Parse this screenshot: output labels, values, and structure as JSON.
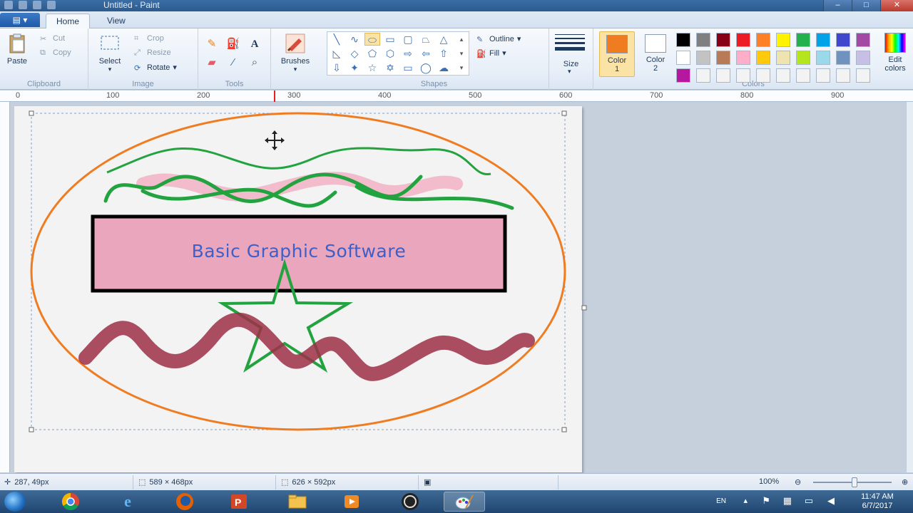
{
  "window": {
    "title": "Untitled - Paint"
  },
  "tabs": [
    {
      "label": "Home",
      "active": true
    },
    {
      "label": "View",
      "active": false
    }
  ],
  "ribbon": {
    "clipboard": {
      "label": "Clipboard",
      "paste": "Paste",
      "cut": "Cut",
      "copy": "Copy"
    },
    "image": {
      "label": "Image",
      "select": "Select",
      "crop": "Crop",
      "resize": "Resize",
      "rotate": "Rotate"
    },
    "tools": {
      "label": "Tools"
    },
    "brushes": {
      "label": "Brushes"
    },
    "shapes": {
      "label": "Shapes",
      "outline": "Outline",
      "fill": "Fill"
    },
    "size": {
      "label": "Size"
    },
    "colors": {
      "label": "Colors",
      "color1_label": "Color",
      "color1_num": "1",
      "color2_label": "Color",
      "color2_num": "2",
      "color1": "#f07c22",
      "color2": "#ffffff",
      "edit": "Edit colors",
      "palette": [
        "#000000",
        "#7f7f7f",
        "#880015",
        "#ed1c24",
        "#ff7f27",
        "#fff200",
        "#22b14c",
        "#00a2e8",
        "#3f48cc",
        "#a349a4",
        "#ffffff",
        "#c3c3c3",
        "#b97a57",
        "#ffaec9",
        "#ffc90e",
        "#efe4b0",
        "#b5e61d",
        "#99d9ea",
        "#7092be",
        "#c8bfe7",
        "#b5179e",
        "#f3f3f3",
        "#f3f3f3",
        "#f3f3f3",
        "#f3f3f3",
        "#f3f3f3",
        "#f3f3f3",
        "#f3f3f3",
        "#f3f3f3",
        "#f3f3f3"
      ]
    }
  },
  "ruler": {
    "labels": [
      "0",
      "100",
      "200",
      "300",
      "400",
      "500",
      "600",
      "700",
      "800",
      "900"
    ]
  },
  "canvas": {
    "banner_text": "Basic Graphic Software",
    "colors": {
      "ellipse": "#f07c22",
      "scribble": "#22a33f",
      "pink": "#f2a9bf",
      "banner_fill": "#eaa6bc",
      "star": "#22a33f",
      "wave": "#9c2f45"
    }
  },
  "status": {
    "cursor_pos": "287, 49px",
    "selection_size": "589 × 468px",
    "image_size": "626 × 592px",
    "zoom": "100%"
  },
  "tray": {
    "lang": "EN",
    "time": "11:47 AM",
    "date": "6/7/2017"
  }
}
